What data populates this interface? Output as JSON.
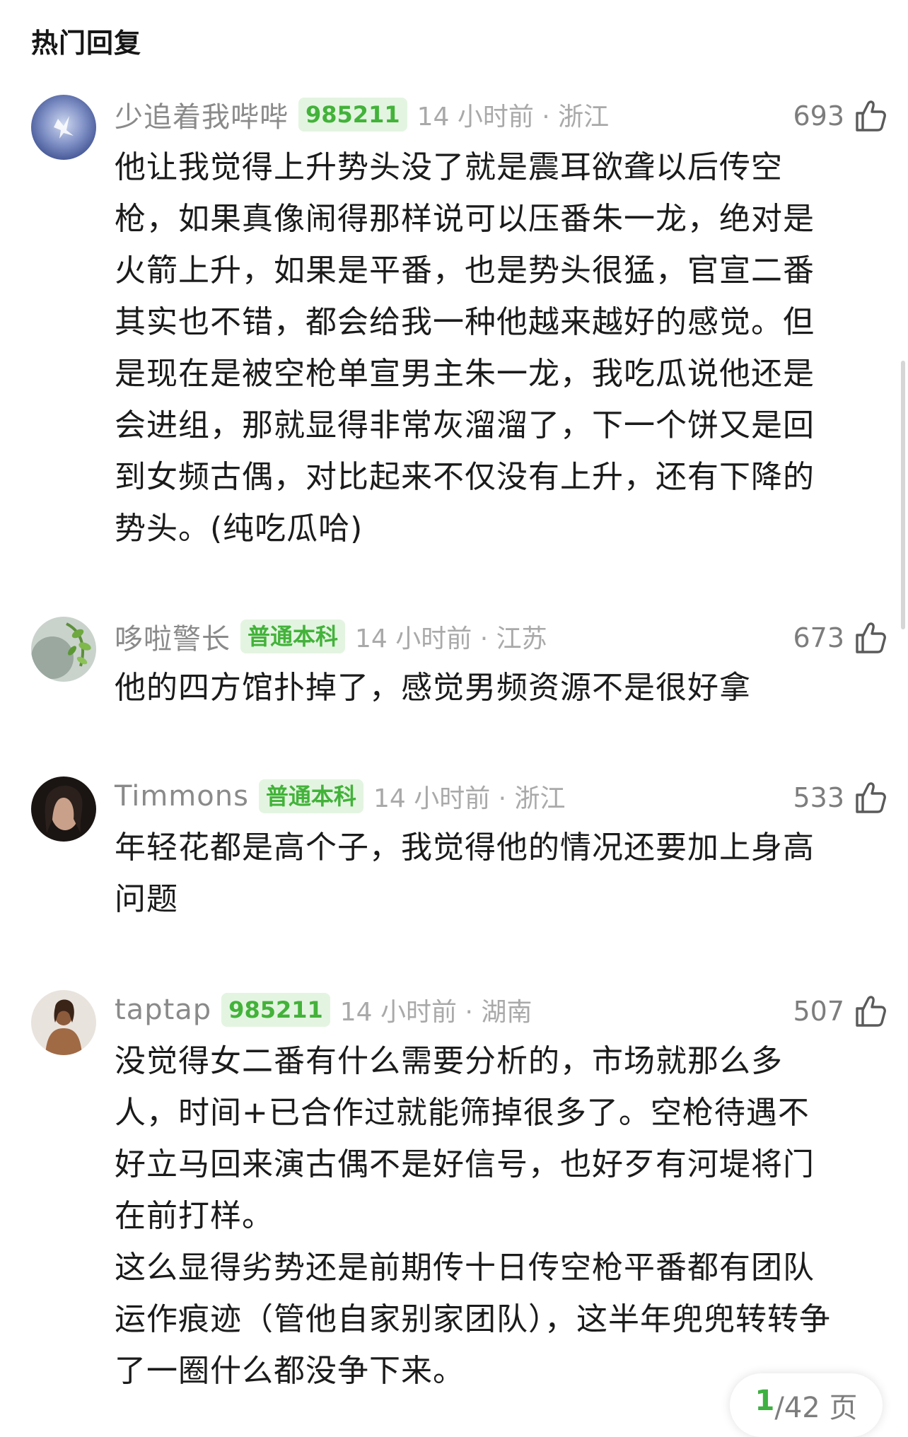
{
  "section_title": "热门回复",
  "colors": {
    "accent": "#43b23a",
    "badge_bg": "#e3f5e1",
    "meta_text": "#a9a9a9"
  },
  "comments": [
    {
      "username": "少追着我哔哔",
      "badge": "985211",
      "time_location": "14 小时前 · 浙江",
      "likes": "693",
      "like_icon": "thumbs-up-icon",
      "avatar": "avatar-blue-butterfly",
      "content": "他让我觉得上升势头没了就是震耳欲聋以后传空\n枪，如果真像闹得那样说可以压番朱一龙，绝对是\n火箭上升，如果是平番，也是势头很猛，官宣二番\n其实也不错，都会给我一种他越来越好的感觉。但\n是现在是被空枪单宣男主朱一龙，我吃瓜说他还是\n会进组，那就显得非常灰溜溜了，下一个饼又是回\n到女频古偶，对比起来不仅没有上升，还有下降的\n势头。(纯吃瓜哈)"
    },
    {
      "username": "哆啦警长",
      "badge": "普通本科",
      "time_location": "14 小时前 · 江苏",
      "likes": "673",
      "like_icon": "thumbs-up-icon",
      "avatar": "avatar-green-leaves",
      "content": "他的四方馆扑掉了，感觉男频资源不是很好拿"
    },
    {
      "username": "Timmons",
      "badge": "普通本科",
      "time_location": "14 小时前 · 浙江",
      "likes": "533",
      "like_icon": "thumbs-up-icon",
      "avatar": "avatar-dark-portrait",
      "content": "年轻花都是高个子，我觉得他的情况还要加上身高\n问题"
    },
    {
      "username": "taptap",
      "badge": "985211",
      "time_location": "14 小时前 · 湖南",
      "likes": "507",
      "like_icon": "thumbs-up-icon",
      "avatar": "avatar-woman-photo",
      "content": "没觉得女二番有什么需要分析的，市场就那么多\n人，时间+已合作过就能筛掉很多了。空枪待遇不\n好立马回来演古偶不是好信号，也好歹有河堤将门\n在前打样。\n这么显得劣势还是前期传十日传空枪平番都有团队\n运作痕迹（管他自家别家团队），这半年兜兜转转争\n了一圈什么都没争下来。"
    }
  ],
  "pagination": {
    "current": "1",
    "total": "/42 页"
  }
}
